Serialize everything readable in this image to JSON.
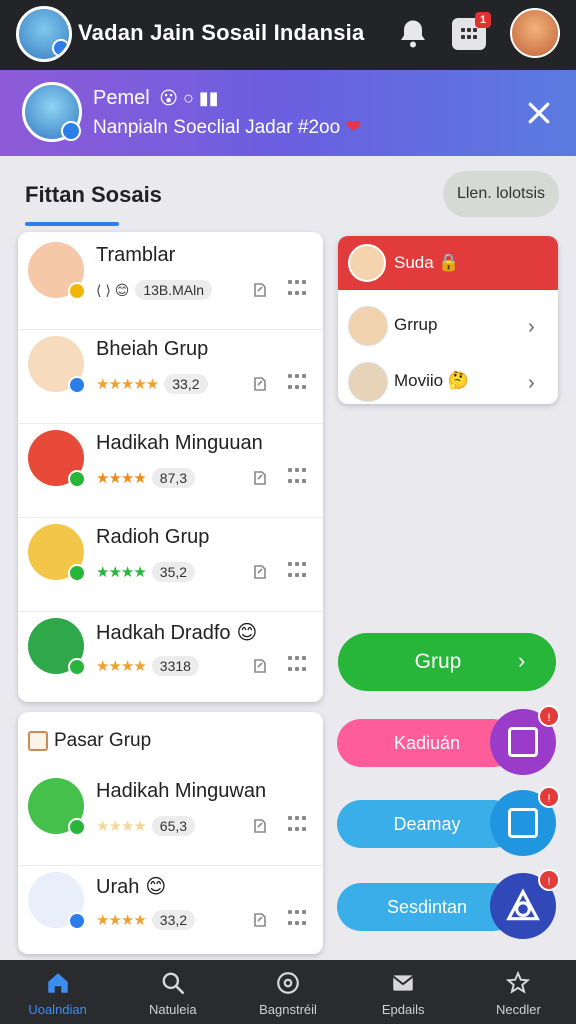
{
  "header": {
    "title": "Vadan Jain Sosail Indansia",
    "apps_count": "1"
  },
  "banner": {
    "name": "Pemel",
    "name_emoji": "😮 ○ ▮▮",
    "subtitle": "Nanpialn Soeclial Jadar #2oo",
    "heart": "❤"
  },
  "section": {
    "title": "Fittan Sosais",
    "action_label": "Llen. lolotsis"
  },
  "list_main": [
    {
      "name": "Tramblar",
      "prefix": "⟨ ⟩ 😊",
      "stars": "",
      "value": "13B.MAln",
      "badge_color": "#f2b705",
      "pic_color": "#f5c9a8"
    },
    {
      "name": "Bheiah Grup",
      "prefix": "",
      "stars": "★★★★★",
      "star_color": "#f0a030",
      "value": "33,2",
      "badge_color": "#2b7de9",
      "pic_color": "#f6dcbc"
    },
    {
      "name": "Hadikah Minguuan",
      "prefix": "",
      "stars": "★★★★",
      "star_color": "#f08a1a",
      "value": "87,3",
      "badge_color": "#27b53a",
      "pic_color": "#e84a3a"
    },
    {
      "name": "Radioh Grup",
      "prefix": "",
      "stars": "★★★★",
      "star_color": "#27b53a",
      "value": "35,2",
      "badge_color": "#27b53a",
      "pic_color": "#f3c64a"
    },
    {
      "name": "Hadkah Dradfo",
      "prefix": "",
      "stars": "★★★★",
      "star_color": "#f0a030",
      "value": "3318",
      "badge_color": "#27b53a",
      "pic_color": "#2fa84a",
      "emoji": "😊"
    }
  ],
  "list_second": {
    "header": "Pasar Grup",
    "items": [
      {
        "name": "Hadikah Minguwan",
        "stars": "★★★★",
        "star_color": "#f3d89a",
        "value": "65,3",
        "badge_color": "#27b53a",
        "pic_color": "#45c04a"
      },
      {
        "name": "Urah",
        "emoji": "😊",
        "stars": "★★★★",
        "star_color": "#f0a030",
        "value": "33,2",
        "badge_color": "#2b7de9",
        "pic_color": "#e8eefa"
      }
    ]
  },
  "menu": {
    "header": "Suda 🔒",
    "items": [
      {
        "label": "Grrup"
      },
      {
        "label": "Moviio 🤔"
      }
    ]
  },
  "actions": {
    "grup": "Grup",
    "kadiuan": "Kadiuán",
    "deamay": "Deamay",
    "sesdintan": "Sesdintan"
  },
  "nav": {
    "items": [
      {
        "label": "Uoalndian"
      },
      {
        "label": "Natuleia"
      },
      {
        "label": "Bagnstréil"
      },
      {
        "label": "Epdails"
      },
      {
        "label": "Necdler"
      }
    ]
  },
  "colors": {
    "accent": "#2b7de9",
    "topbar": "#232427",
    "banner_start": "#8e5bd8",
    "banner_end": "#5b7be0",
    "grup_green": "#27b53a",
    "pink": "#ff5c9a",
    "blue": "#3aaee8",
    "red": "#e13b3b"
  }
}
